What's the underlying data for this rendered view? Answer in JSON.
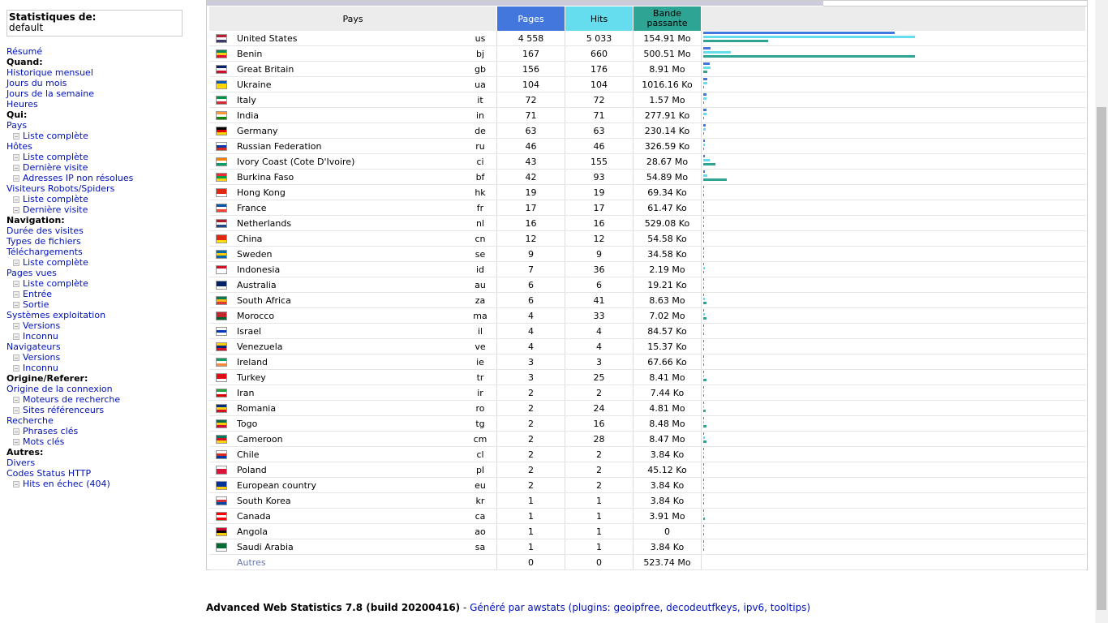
{
  "stats": {
    "title": "Statistiques de:",
    "site": "default"
  },
  "menu": [
    {
      "type": "link",
      "label": "Résumé",
      "name": "menu-resume"
    },
    {
      "type": "cat",
      "label": "Quand:",
      "name": "menu-cat-quand"
    },
    {
      "type": "link",
      "label": "Historique mensuel",
      "name": "menu-historique-mensuel"
    },
    {
      "type": "link",
      "label": "Jours du mois",
      "name": "menu-jours-du-mois"
    },
    {
      "type": "link",
      "label": "Jours de la semaine",
      "name": "menu-jours-de-la-semaine"
    },
    {
      "type": "link",
      "label": "Heures",
      "name": "menu-heures"
    },
    {
      "type": "cat",
      "label": "Qui:",
      "name": "menu-cat-qui"
    },
    {
      "type": "link",
      "label": "Pays",
      "name": "menu-pays"
    },
    {
      "type": "sub",
      "label": "Liste complète",
      "name": "menu-pays-liste-complete"
    },
    {
      "type": "link",
      "label": "Hôtes",
      "name": "menu-hotes"
    },
    {
      "type": "sub",
      "label": "Liste complète",
      "name": "menu-hotes-liste-complete"
    },
    {
      "type": "sub",
      "label": "Dernière visite",
      "name": "menu-hotes-derniere-visite"
    },
    {
      "type": "sub",
      "label": "Adresses IP non résolues",
      "name": "menu-hotes-ip-non-resolues"
    },
    {
      "type": "link",
      "label": "Visiteurs Robots/Spiders",
      "name": "menu-robots"
    },
    {
      "type": "sub",
      "label": "Liste complète",
      "name": "menu-robots-liste-complete"
    },
    {
      "type": "sub",
      "label": "Dernière visite",
      "name": "menu-robots-derniere-visite"
    },
    {
      "type": "cat",
      "label": "Navigation:",
      "name": "menu-cat-navigation"
    },
    {
      "type": "link",
      "label": "Durée des visites",
      "name": "menu-duree-visites"
    },
    {
      "type": "link",
      "label": "Types de fichiers",
      "name": "menu-types-fichiers"
    },
    {
      "type": "link",
      "label": "Téléchargements",
      "name": "menu-telechargements"
    },
    {
      "type": "sub",
      "label": "Liste complète",
      "name": "menu-telechargements-liste-complete"
    },
    {
      "type": "link",
      "label": "Pages vues",
      "name": "menu-pages-vues"
    },
    {
      "type": "sub",
      "label": "Liste complète",
      "name": "menu-pages-liste-complete"
    },
    {
      "type": "sub",
      "label": "Entrée",
      "name": "menu-pages-entree"
    },
    {
      "type": "sub",
      "label": "Sortie",
      "name": "menu-pages-sortie"
    },
    {
      "type": "link",
      "label": "Systèmes exploitation",
      "name": "menu-systemes"
    },
    {
      "type": "sub",
      "label": "Versions",
      "name": "menu-systemes-versions"
    },
    {
      "type": "sub",
      "label": "Inconnu",
      "name": "menu-systemes-inconnu"
    },
    {
      "type": "link",
      "label": "Navigateurs",
      "name": "menu-navigateurs"
    },
    {
      "type": "sub",
      "label": "Versions",
      "name": "menu-navigateurs-versions"
    },
    {
      "type": "sub",
      "label": "Inconnu",
      "name": "menu-navigateurs-inconnu"
    },
    {
      "type": "cat",
      "label": "Origine/Referer:",
      "name": "menu-cat-origine"
    },
    {
      "type": "link",
      "label": "Origine de la connexion",
      "name": "menu-origine-connexion"
    },
    {
      "type": "sub",
      "label": "Moteurs de recherche",
      "name": "menu-moteurs-recherche"
    },
    {
      "type": "sub",
      "label": "Sites référenceurs",
      "name": "menu-sites-referenceurs"
    },
    {
      "type": "link",
      "label": "Recherche",
      "name": "menu-recherche"
    },
    {
      "type": "sub",
      "label": "Phrases clés",
      "name": "menu-phrases-cles"
    },
    {
      "type": "sub",
      "label": "Mots clés",
      "name": "menu-mots-cles"
    },
    {
      "type": "cat",
      "label": "Autres:",
      "name": "menu-cat-autres"
    },
    {
      "type": "link",
      "label": "Divers",
      "name": "menu-divers"
    },
    {
      "type": "link",
      "label": "Codes Status HTTP",
      "name": "menu-codes-status"
    },
    {
      "type": "sub",
      "label": "Hits en échec (404)",
      "name": "menu-hits-echec"
    }
  ],
  "table": {
    "headers": {
      "country": "Pays",
      "pages": "Pages",
      "hits": "Hits",
      "bandwidth": "Bande passante"
    },
    "rows": [
      {
        "country": "United States",
        "code": "us",
        "pages": "4 558",
        "hits": "5 033",
        "bw": "154.91 Mo",
        "bars": [
          0.905,
          1.0,
          0.308
        ]
      },
      {
        "country": "Benin",
        "code": "bj",
        "pages": "167",
        "hits": "660",
        "bw": "500.51 Mo",
        "bars": [
          0.033,
          0.131,
          1.0
        ]
      },
      {
        "country": "Great Britain",
        "code": "gb",
        "pages": "156",
        "hits": "176",
        "bw": "8.91 Mo",
        "bars": [
          0.031,
          0.035,
          0.018
        ]
      },
      {
        "country": "Ukraine",
        "code": "ua",
        "pages": "104",
        "hits": "104",
        "bw": "1016.16 Ko",
        "bars": [
          0.021,
          0.021,
          0.002
        ]
      },
      {
        "country": "Italy",
        "code": "it",
        "pages": "72",
        "hits": "72",
        "bw": "1.57 Mo",
        "bars": [
          0.014,
          0.014,
          0.003
        ]
      },
      {
        "country": "India",
        "code": "in",
        "pages": "71",
        "hits": "71",
        "bw": "277.91 Ko",
        "bars": [
          0.014,
          0.014,
          0.001
        ]
      },
      {
        "country": "Germany",
        "code": "de",
        "pages": "63",
        "hits": "63",
        "bw": "230.14 Ko",
        "bars": [
          0.012,
          0.012,
          0.001
        ]
      },
      {
        "country": "Russian Federation",
        "code": "ru",
        "pages": "46",
        "hits": "46",
        "bw": "326.59 Ko",
        "bars": [
          0.009,
          0.009,
          0.001
        ]
      },
      {
        "country": "Ivory Coast (Cote D'Ivoire)",
        "code": "ci",
        "pages": "43",
        "hits": "155",
        "bw": "28.67 Mo",
        "bars": [
          0.009,
          0.031,
          0.057
        ]
      },
      {
        "country": "Burkina Faso",
        "code": "bf",
        "pages": "42",
        "hits": "93",
        "bw": "54.89 Mo",
        "bars": [
          0.008,
          0.018,
          0.11
        ]
      },
      {
        "country": "Hong Kong",
        "code": "hk",
        "pages": "19",
        "hits": "19",
        "bw": "69.34 Ko",
        "bars": [
          0.004,
          0.004,
          0.0
        ]
      },
      {
        "country": "France",
        "code": "fr",
        "pages": "17",
        "hits": "17",
        "bw": "61.47 Ko",
        "bars": [
          0.003,
          0.003,
          0.0
        ]
      },
      {
        "country": "Netherlands",
        "code": "nl",
        "pages": "16",
        "hits": "16",
        "bw": "529.08 Ko",
        "bars": [
          0.003,
          0.003,
          0.001
        ]
      },
      {
        "country": "China",
        "code": "cn",
        "pages": "12",
        "hits": "12",
        "bw": "54.58 Ko",
        "bars": [
          0.002,
          0.002,
          0.0
        ]
      },
      {
        "country": "Sweden",
        "code": "se",
        "pages": "9",
        "hits": "9",
        "bw": "34.58 Ko",
        "bars": [
          0.002,
          0.002,
          0.0
        ]
      },
      {
        "country": "Indonesia",
        "code": "id",
        "pages": "7",
        "hits": "36",
        "bw": "2.19 Mo",
        "bars": [
          0.001,
          0.007,
          0.004
        ]
      },
      {
        "country": "Australia",
        "code": "au",
        "pages": "6",
        "hits": "6",
        "bw": "19.21 Ko",
        "bars": [
          0.001,
          0.001,
          0.0
        ]
      },
      {
        "country": "South Africa",
        "code": "za",
        "pages": "6",
        "hits": "41",
        "bw": "8.63 Mo",
        "bars": [
          0.001,
          0.008,
          0.017
        ]
      },
      {
        "country": "Morocco",
        "code": "ma",
        "pages": "4",
        "hits": "33",
        "bw": "7.02 Mo",
        "bars": [
          0.001,
          0.007,
          0.014
        ]
      },
      {
        "country": "Israel",
        "code": "il",
        "pages": "4",
        "hits": "4",
        "bw": "84.57 Ko",
        "bars": [
          0.001,
          0.001,
          0.0
        ]
      },
      {
        "country": "Venezuela",
        "code": "ve",
        "pages": "4",
        "hits": "4",
        "bw": "15.37 Ko",
        "bars": [
          0.001,
          0.001,
          0.0
        ]
      },
      {
        "country": "Ireland",
        "code": "ie",
        "pages": "3",
        "hits": "3",
        "bw": "67.66 Ko",
        "bars": [
          0.001,
          0.001,
          0.0
        ]
      },
      {
        "country": "Turkey",
        "code": "tr",
        "pages": "3",
        "hits": "25",
        "bw": "8.41 Mo",
        "bars": [
          0.001,
          0.005,
          0.017
        ]
      },
      {
        "country": "Iran",
        "code": "ir",
        "pages": "2",
        "hits": "2",
        "bw": "7.44 Ko",
        "bars": [
          0.0,
          0.0,
          0.0
        ]
      },
      {
        "country": "Romania",
        "code": "ro",
        "pages": "2",
        "hits": "24",
        "bw": "4.81 Mo",
        "bars": [
          0.0,
          0.005,
          0.01
        ]
      },
      {
        "country": "Togo",
        "code": "tg",
        "pages": "2",
        "hits": "16",
        "bw": "8.48 Mo",
        "bars": [
          0.0,
          0.003,
          0.017
        ]
      },
      {
        "country": "Cameroon",
        "code": "cm",
        "pages": "2",
        "hits": "28",
        "bw": "8.47 Mo",
        "bars": [
          0.0,
          0.006,
          0.017
        ]
      },
      {
        "country": "Chile",
        "code": "cl",
        "pages": "2",
        "hits": "2",
        "bw": "3.84 Ko",
        "bars": [
          0.0,
          0.0,
          0.0
        ]
      },
      {
        "country": "Poland",
        "code": "pl",
        "pages": "2",
        "hits": "2",
        "bw": "45.12 Ko",
        "bars": [
          0.0,
          0.0,
          0.0
        ]
      },
      {
        "country": "European country",
        "code": "eu",
        "pages": "2",
        "hits": "2",
        "bw": "3.84 Ko",
        "bars": [
          0.0,
          0.0,
          0.0
        ]
      },
      {
        "country": "South Korea",
        "code": "kr",
        "pages": "1",
        "hits": "1",
        "bw": "3.84 Ko",
        "bars": [
          0.0,
          0.0,
          0.0
        ]
      },
      {
        "country": "Canada",
        "code": "ca",
        "pages": "1",
        "hits": "1",
        "bw": "3.91 Mo",
        "bars": [
          0.0,
          0.0,
          0.008
        ]
      },
      {
        "country": "Angola",
        "code": "ao",
        "pages": "1",
        "hits": "1",
        "bw": "0",
        "bars": [
          0.0,
          0.0,
          0.0
        ]
      },
      {
        "country": "Saudi Arabia",
        "code": "sa",
        "pages": "1",
        "hits": "1",
        "bw": "3.84 Ko",
        "bars": [
          0.0,
          0.0,
          0.0
        ]
      }
    ],
    "other": {
      "label": "Autres",
      "pages": "0",
      "hits": "0",
      "bw": "523.74 Mo"
    }
  },
  "flags": {
    "us": [
      "#b22234",
      "#fff",
      "#3c3b6e"
    ],
    "bj": [
      "#008751",
      "#fcd116",
      "#e8112d"
    ],
    "gb": [
      "#012169",
      "#fff",
      "#c8102e"
    ],
    "ua": [
      "#0057b7",
      "#ffd700",
      "#ffd700"
    ],
    "it": [
      "#009246",
      "#fff",
      "#ce2b37"
    ],
    "in": [
      "#ff9933",
      "#fff",
      "#138808"
    ],
    "de": [
      "#000",
      "#dd0000",
      "#ffce00"
    ],
    "ru": [
      "#fff",
      "#0039a6",
      "#d52b1e"
    ],
    "ci": [
      "#f77f00",
      "#fff",
      "#009e60"
    ],
    "bf": [
      "#ef2b2d",
      "#009e49",
      "#fcd116"
    ],
    "hk": [
      "#de2910",
      "#de2910",
      "#fff"
    ],
    "fr": [
      "#0055a4",
      "#fff",
      "#ef4135"
    ],
    "nl": [
      "#ae1c28",
      "#fff",
      "#21468b"
    ],
    "cn": [
      "#de2910",
      "#de2910",
      "#ffde00"
    ],
    "se": [
      "#006aa7",
      "#fecc00",
      "#006aa7"
    ],
    "id": [
      "#ce1126",
      "#fff",
      "#fff"
    ],
    "au": [
      "#012169",
      "#012169",
      "#fff"
    ],
    "za": [
      "#007a4d",
      "#ffb612",
      "#de3831"
    ],
    "ma": [
      "#c1272d",
      "#c1272d",
      "#006233"
    ],
    "il": [
      "#fff",
      "#0038b8",
      "#fff"
    ],
    "ve": [
      "#ffcc00",
      "#00247d",
      "#cf142b"
    ],
    "ie": [
      "#169b62",
      "#fff",
      "#ff883e"
    ],
    "tr": [
      "#e30a17",
      "#e30a17",
      "#fff"
    ],
    "ir": [
      "#239f40",
      "#fff",
      "#da0000"
    ],
    "ro": [
      "#002b7f",
      "#fcd116",
      "#ce1126"
    ],
    "tg": [
      "#006a4e",
      "#ffce00",
      "#d21034"
    ],
    "cm": [
      "#007a5e",
      "#ce1126",
      "#fcd116"
    ],
    "cl": [
      "#fff",
      "#d52b1e",
      "#0039a6"
    ],
    "pl": [
      "#fff",
      "#dc143c",
      "#dc143c"
    ],
    "eu": [
      "#003399",
      "#003399",
      "#ffcc00"
    ],
    "kr": [
      "#fff",
      "#cd2e3a",
      "#0047a0"
    ],
    "ca": [
      "#ff0000",
      "#fff",
      "#ff0000"
    ],
    "ao": [
      "#cc092f",
      "#000",
      "#ffcb00"
    ],
    "sa": [
      "#006c35",
      "#006c35",
      "#fff"
    ]
  },
  "footer": {
    "title": "Advanced Web Statistics 7.8 (build 20200416)",
    "sep": " - ",
    "link": "Généré par awstats (plugins: geoipfree, decodeutfkeys, ipv6, tooltips)"
  }
}
